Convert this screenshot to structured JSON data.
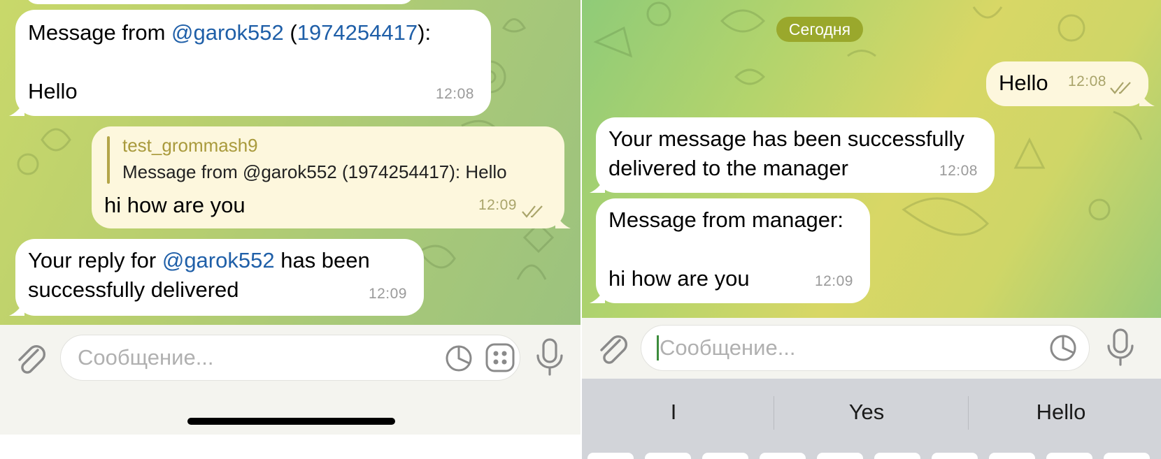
{
  "left": {
    "messages": [
      {
        "from_prefix": "Message from ",
        "username": "@garok552",
        "open_paren": " (",
        "user_id": "1974254417",
        "close_paren": "):",
        "body": "Hello",
        "time": "12:08"
      },
      {
        "reply_author": "test_grommash9",
        "reply_text": "Message from @garok552 (1974254417): Hello",
        "body": "hi how are you",
        "time": "12:09"
      },
      {
        "text_prefix": "Your reply for ",
        "username": "@garok552",
        "text_suffix": " has been",
        "line2": "successfully delivered",
        "time": "12:09"
      }
    ],
    "input_placeholder": "Сообщение..."
  },
  "right": {
    "date_label": "Сегодня",
    "messages": [
      {
        "body": "Hello",
        "time": "12:08"
      },
      {
        "line1": "Your message has been successfully",
        "line2": "delivered to the manager",
        "time": "12:08"
      },
      {
        "line1": "Message from manager:",
        "line2": "hi how are you",
        "time": "12:09"
      }
    ],
    "input_placeholder": "Сообщение...",
    "suggestions": [
      "I",
      "Yes",
      "Hello"
    ]
  },
  "colors": {
    "accent_link": "#1f5fa8",
    "date_pill": "#9aa82c",
    "outgoing_bubble": "#fdf7dd"
  },
  "icons": [
    "attach-icon",
    "sticker-icon",
    "keyboard-grid-icon",
    "microphone-icon",
    "double-check-icon"
  ]
}
